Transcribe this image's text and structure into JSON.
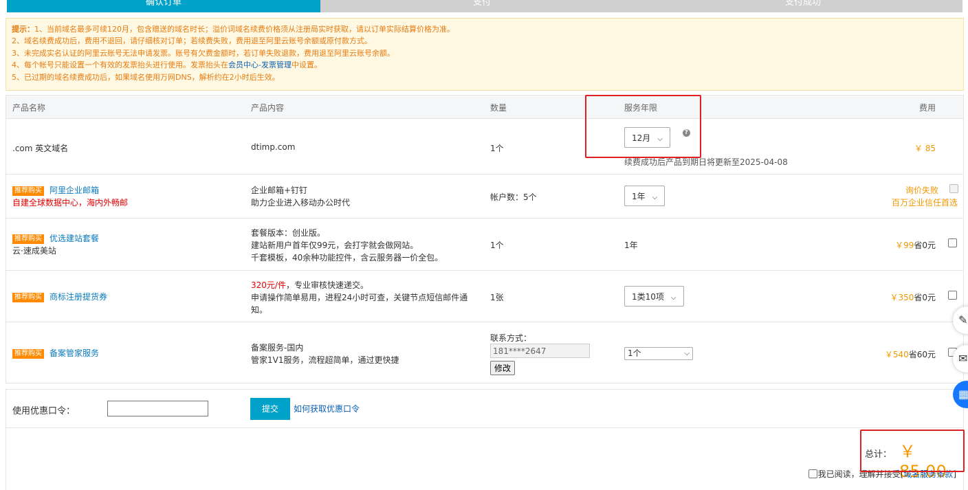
{
  "steps": [
    "确认订单",
    "支付",
    "支付成功"
  ],
  "tips": {
    "head": "提示：",
    "lines": [
      "1、当前域名最多可续120月，包含赠送的域名时长；溢价词域名续费价格须从注册局实时获取，请以订单实际结算价格为准。",
      "2、域名续费成功后，费用不退回，请仔细核对订单；若续费失败，费用退至阿里云账号余额或原付款方式。",
      "3、未完成实名认证的阿里云账号无法申请发票。账号有欠费金额时，若订单失败退款，费用退至阿里云账号余额。"
    ],
    "line4_pre": "4、每个帐号只能设置一个有效的发票抬头进行使用。发票抬头在",
    "line4_link": "会员中心-发票管理",
    "line4_post": "中设置。",
    "line5": "5、已过期的域名续费成功后，如果域名使用万网DNS，解析约在2小时后生效。"
  },
  "table": {
    "headers": [
      "产品名称",
      "产品内容",
      "数量",
      "服务年限",
      "费用"
    ],
    "row1": {
      "name": ".com 英文域名",
      "content": "dtimp.com",
      "qty": "1个",
      "period": "12月",
      "note": "续费成功后产品到期日将更新至2025-04-08",
      "fee": "￥ 85"
    },
    "row2": {
      "tag": "推荐购买",
      "name": "阿里企业邮箱",
      "sub": "自建全球数据中心，海内外畅邮",
      "content1": "企业邮箱+钉钉",
      "content2": "助力企业进入移动办公时代",
      "qty": "帐户数：5个",
      "period": "1年",
      "fee1": "询价失败",
      "fee2": "百万企业信任首选"
    },
    "row3": {
      "tag": "推荐购买",
      "name": "优选建站套餐",
      "sub": "云·速成美站",
      "content1": "套餐版本：创业版。",
      "content2": "建站新用户首年仅99元，会打字就会做网站。",
      "content3": "千套模板，40余种功能控件，含云服务器一价全包。",
      "qty": "1个",
      "period": "1年",
      "price": "￥99",
      "save": "省0元"
    },
    "row4": {
      "tag": "推荐购买",
      "name": "商标注册提货券",
      "content_red": "320元/件",
      "content_rest": "，专业审核快速递交。",
      "content2": "申请操作简单易用，进程24小时可查，关键节点短信邮件通",
      "content3": "知。",
      "qty": "1张",
      "period": "1类10项",
      "price": "￥350",
      "save": "省0元"
    },
    "row5": {
      "tag": "推荐购买",
      "name": "备案管家服务",
      "content1": "备案服务-国内",
      "content2": "管家1V1服务，流程超简单，通过更快捷",
      "contact_label": "联系方式：",
      "phone": "181****2647",
      "edit": "修改",
      "period": "1个",
      "price": "￥540",
      "save": "省60元"
    }
  },
  "coupon": {
    "label": "使用优惠口令：",
    "submit": "提交",
    "how": "如何获取优惠口令"
  },
  "total": {
    "label": "总计：",
    "value": "￥ 85.00"
  },
  "agree": {
    "pre": "我已阅读，理解并接受[",
    "link": "域名服务条款",
    "post": "]"
  },
  "colors": {
    "step_active": "#00a2ca",
    "price": "#f39800",
    "highlight": "#e02020"
  }
}
